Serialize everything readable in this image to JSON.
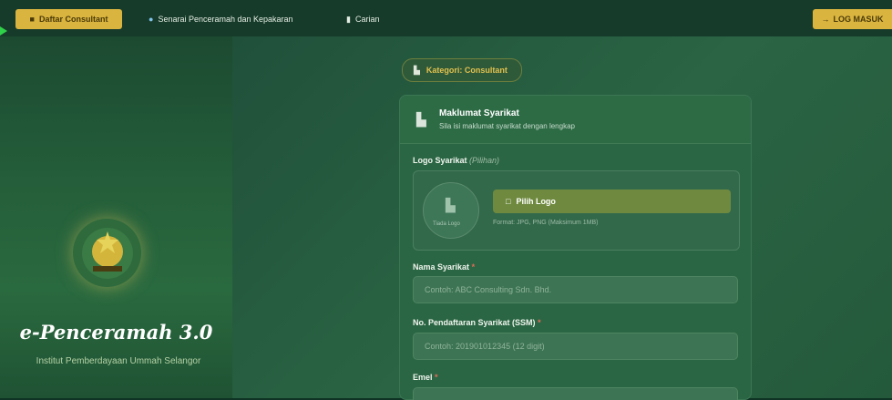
{
  "topbar": {
    "daftar_label": "Daftar Consultant",
    "nav1_label": "Senarai Penceramah dan Kepakaran",
    "nav2_label": "Carian",
    "login_label": "LOG MASUK"
  },
  "sidebar": {
    "brand": "e-Penceramah 3.0",
    "institute": "Institut Pemberdayaan Ummah Selangor"
  },
  "category_pill": {
    "label": "Kategori: Consultant"
  },
  "form": {
    "title": "Maklumat Syarikat",
    "subtitle": "Sila isi maklumat syarikat dengan lengkap",
    "logo_label": "Logo Syarikat",
    "logo_optional": "(Pilihan)",
    "logo_preview_text": "Tiada Logo",
    "pilih_label": "Pilih Logo",
    "format_hint": "Format: JPG, PNG (Maksimum 1MB)",
    "nama_label": "Nama Syarikat",
    "nama_placeholder": "Contoh: ABC Consulting Sdn. Bhd.",
    "ssm_label": "No. Pendaftaran Syarikat (SSM)",
    "ssm_placeholder": "Contoh: 201901012345 (12 digit)",
    "emel_label": "Emel",
    "required_mark": "*"
  },
  "colors": {
    "accent": "#d9b43e",
    "background": "#0f3324",
    "card": "#2b6644"
  }
}
